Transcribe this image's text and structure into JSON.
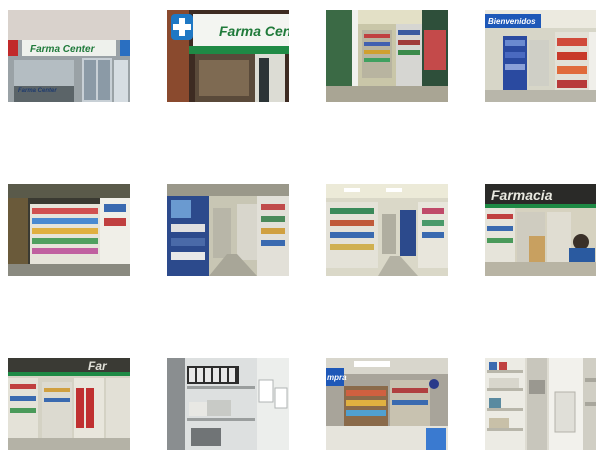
{
  "gallery": {
    "thumbnails": [
      {
        "subject": "storefront",
        "sign": "Farma Center",
        "sign2": "Farma Center"
      },
      {
        "subject": "store-entrance",
        "sign": "Farma Center"
      },
      {
        "subject": "aisle-entrance"
      },
      {
        "subject": "aisle-welcome-sign",
        "sign": "Bienvenidos"
      },
      {
        "subject": "display-shelves"
      },
      {
        "subject": "pharmacy-aisle"
      },
      {
        "subject": "long-aisle"
      },
      {
        "subject": "pharmacy-counter",
        "sign": "Farmacia"
      },
      {
        "subject": "pharmacy-shelves",
        "sign": "Far"
      },
      {
        "subject": "storage-room"
      },
      {
        "subject": "checkout-area",
        "sign": "mpra"
      },
      {
        "subject": "back-shelves"
      }
    ]
  }
}
